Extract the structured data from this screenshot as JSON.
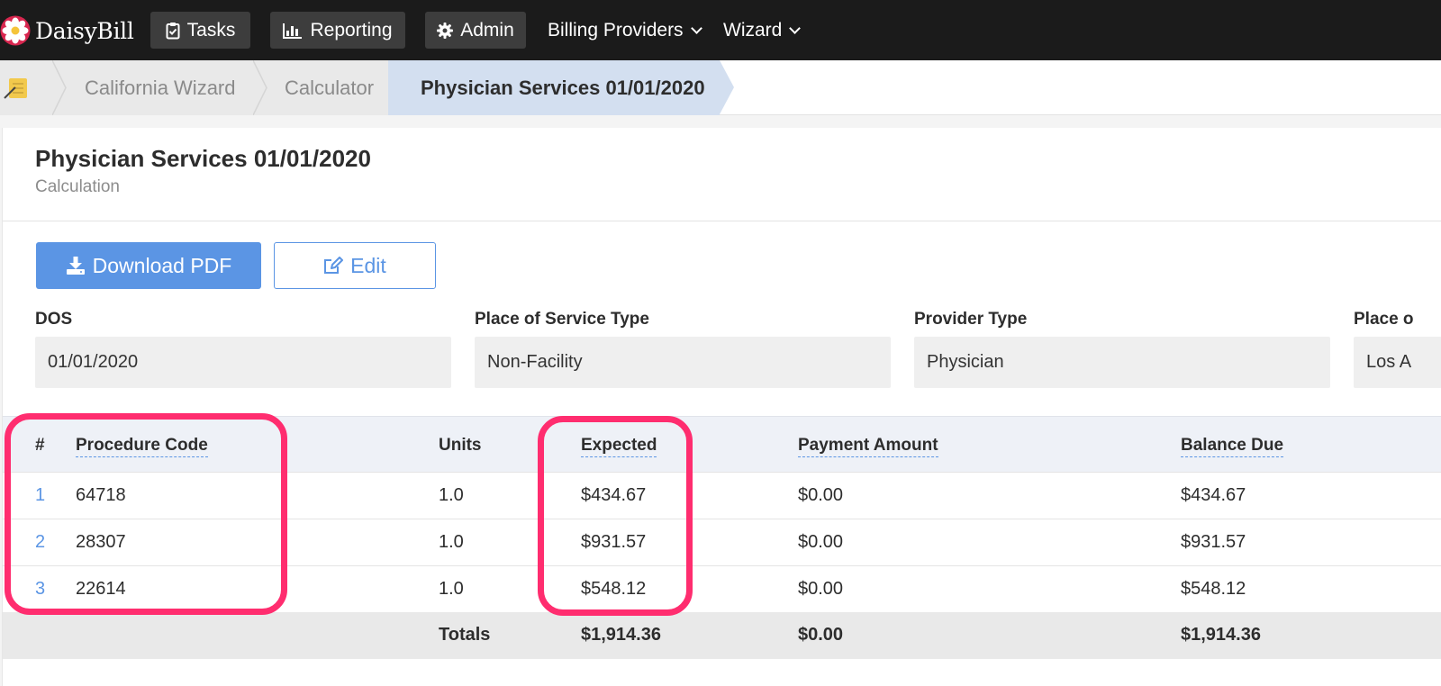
{
  "nav": {
    "brand": "DaisyBill",
    "buttons": [
      {
        "label": "Tasks",
        "icon": "clipboard-check-icon"
      },
      {
        "label": "Reporting",
        "icon": "bar-chart-icon"
      },
      {
        "label": "Admin",
        "icon": "gear-icon"
      }
    ],
    "menus": [
      {
        "label": "Billing Providers"
      },
      {
        "label": "Wizard"
      }
    ]
  },
  "breadcrumb": {
    "items": [
      "California Wizard",
      "Calculator",
      "Physician Services 01/01/2020"
    ]
  },
  "page": {
    "title": "Physician Services 01/01/2020",
    "subtitle": "Calculation"
  },
  "actions": {
    "download_label": "Download PDF",
    "edit_label": "Edit"
  },
  "fields": [
    {
      "label": "DOS",
      "value": "01/01/2020"
    },
    {
      "label": "Place of Service Type",
      "value": "Non-Facility"
    },
    {
      "label": "Provider Type",
      "value": "Physician"
    },
    {
      "label": "Place o",
      "value": "Los A"
    }
  ],
  "table": {
    "headers": {
      "num": "#",
      "code": "Procedure Code",
      "units": "Units",
      "expected": "Expected",
      "payment": "Payment Amount",
      "balance": "Balance Due"
    },
    "rows": [
      {
        "num": "1",
        "code": "64718",
        "units": "1.0",
        "expected": "$434.67",
        "payment": "$0.00",
        "balance": "$434.67"
      },
      {
        "num": "2",
        "code": "28307",
        "units": "1.0",
        "expected": "$931.57",
        "payment": "$0.00",
        "balance": "$931.57"
      },
      {
        "num": "3",
        "code": "22614",
        "units": "1.0",
        "expected": "$548.12",
        "payment": "$0.00",
        "balance": "$548.12"
      }
    ],
    "totals": {
      "label": "Totals",
      "expected": "$1,914.36",
      "payment": "$0.00",
      "balance": "$1,914.36"
    }
  },
  "colors": {
    "accent": "#5b95e4",
    "highlight": "#ff2d6f",
    "nav_bg": "#1b1b1b"
  }
}
